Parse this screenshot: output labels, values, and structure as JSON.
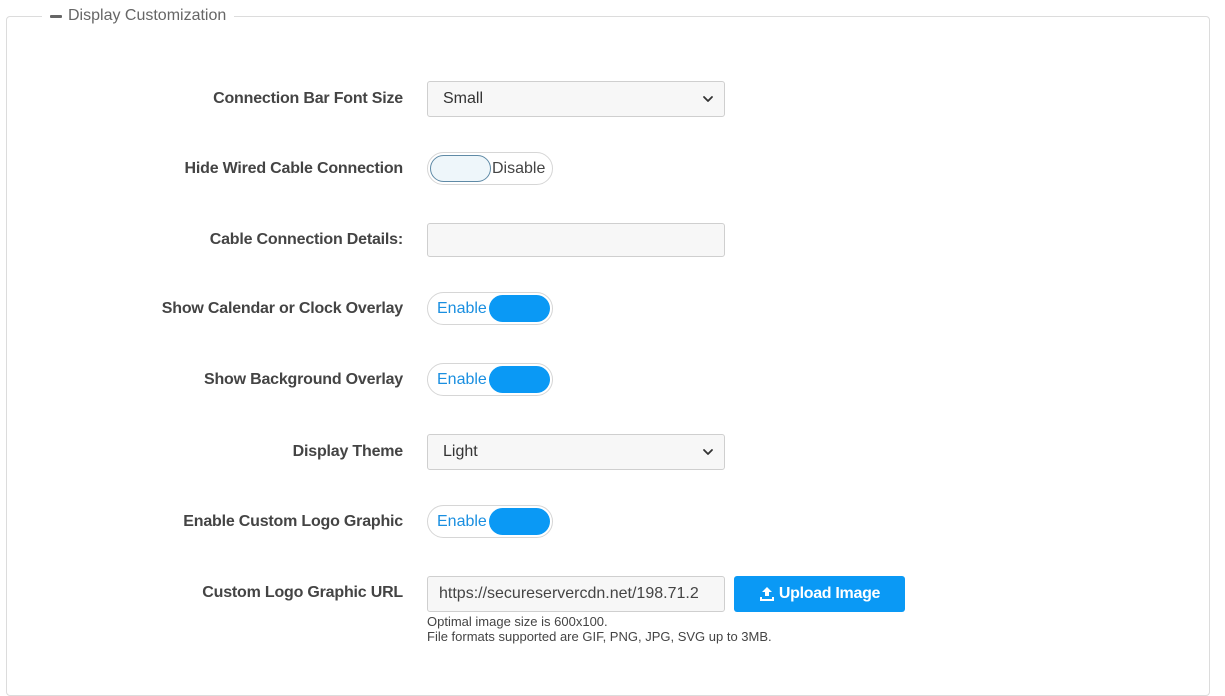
{
  "section": {
    "title": "Display Customization",
    "collapse_icon": "minus-icon"
  },
  "fields": {
    "font_size": {
      "label": "Connection Bar Font Size",
      "value": "Small",
      "icon": "chevron-down-icon"
    },
    "hide_wired": {
      "label": "Hide Wired Cable Connection",
      "state": "Disable"
    },
    "cable_details": {
      "label": "Cable Connection Details:",
      "value": ""
    },
    "calendar_clock": {
      "label": "Show Calendar or Clock Overlay",
      "state": "Enable"
    },
    "background_overlay": {
      "label": "Show Background Overlay",
      "state": "Enable"
    },
    "display_theme": {
      "label": "Display Theme",
      "value": "Light",
      "icon": "chevron-down-icon"
    },
    "custom_logo": {
      "label": "Enable Custom Logo Graphic",
      "state": "Enable"
    },
    "logo_url": {
      "label": "Custom Logo Graphic URL",
      "value": "https://secureservercdn.net/198.71.2",
      "upload_label": "Upload Image",
      "upload_icon": "upload-icon",
      "help_line1": "Optimal image size is 600x100.",
      "help_line2": "File formats supported are GIF, PNG, JPG, SVG up to 3MB."
    }
  },
  "colors": {
    "accent": "#0a99f5",
    "label": "#444444",
    "border": "#dcdcdc"
  }
}
